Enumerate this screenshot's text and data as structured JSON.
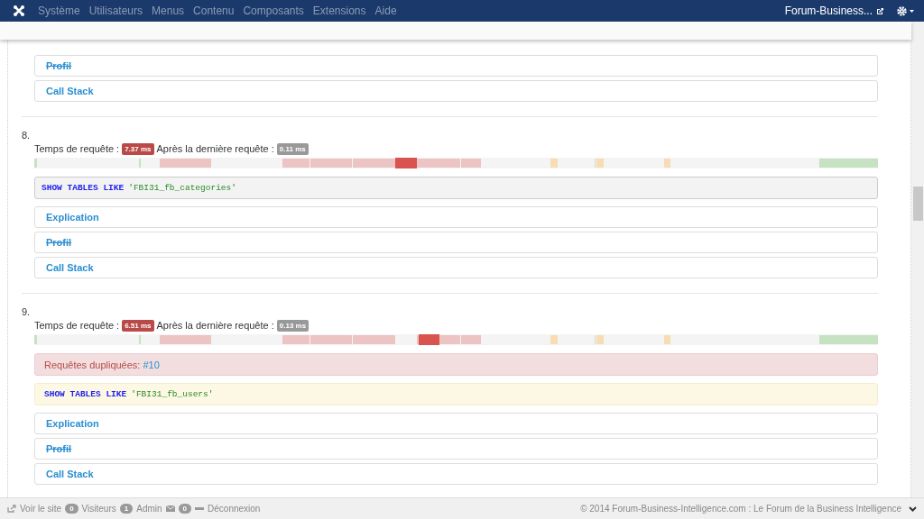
{
  "navbar": {
    "menu": [
      "Système",
      "Utilisateurs",
      "Menus",
      "Contenu",
      "Composants",
      "Extensions",
      "Aide"
    ],
    "site_link": "Forum-Business..."
  },
  "queries": [
    {
      "links": [
        {
          "label": "Profil",
          "disabled": true
        },
        {
          "label": "Call Stack",
          "disabled": false
        }
      ]
    },
    {
      "number": "8.",
      "time_label": "Temps de requête :",
      "time": "7.37 ms",
      "after_label": "Après la dernière requête :",
      "after": "0.11 ms",
      "sql_highlighted": false,
      "sql": [
        {
          "kind": "keyword",
          "text": "SHOW TABLES LIKE"
        },
        {
          "kind": "string",
          "text": "'FBI31_fb_categories'"
        }
      ],
      "links": [
        {
          "label": "Explication",
          "disabled": false
        },
        {
          "label": "Profil",
          "disabled": true
        },
        {
          "label": "Call Stack",
          "disabled": false
        }
      ]
    },
    {
      "number": "9.",
      "time_label": "Temps de requête :",
      "time": "6.51 ms",
      "after_label": "Après la dernière requête :",
      "after": "0.13 ms",
      "duplicates": {
        "label": "Requêtes dupliquées:",
        "link": "#10"
      },
      "sql_highlighted": true,
      "sql": [
        {
          "kind": "keyword",
          "text": "SHOW TABLES LIKE"
        },
        {
          "kind": "string",
          "text": "'FBI31_fb_users'"
        }
      ],
      "links": [
        {
          "label": "Explication",
          "disabled": false
        },
        {
          "label": "Profil",
          "disabled": true
        },
        {
          "label": "Call Stack",
          "disabled": false
        }
      ]
    }
  ],
  "footer": {
    "view_site": "Voir le site",
    "visitors_count": "0",
    "visitors": "Visiteurs",
    "admin_count": "1",
    "admin": "Admin",
    "messages_count": "0",
    "logout": "Déconnexion",
    "copyright": "© 2014 Forum-Business-Intelligence.com : Le Forum de la Business Intelligence"
  }
}
